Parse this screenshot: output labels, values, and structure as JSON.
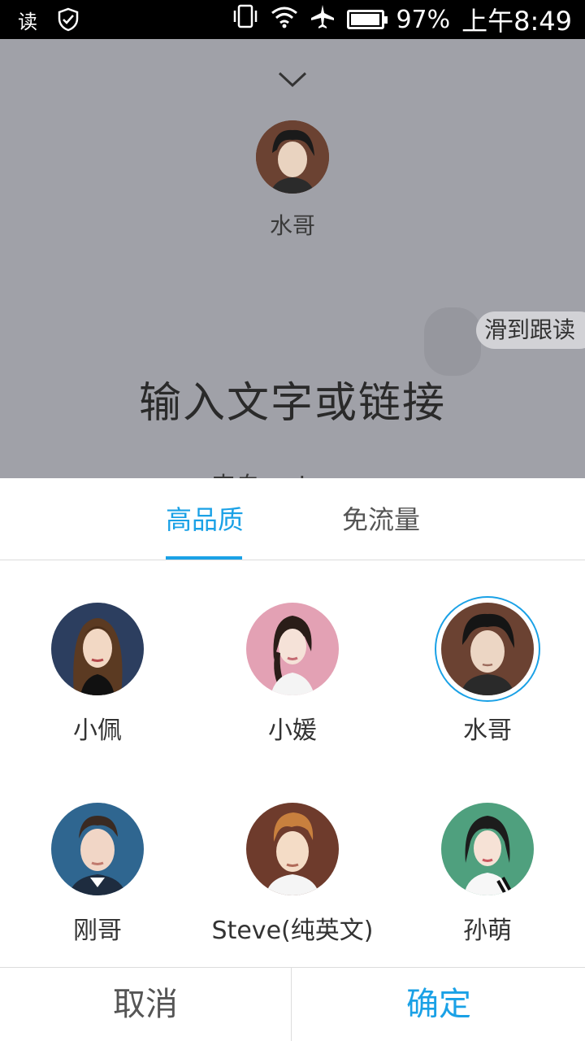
{
  "status_bar": {
    "read_icon_text": "读",
    "battery_percent": "97%",
    "battery_level": 0.97,
    "time": "上午8:49"
  },
  "player": {
    "current_voice_name": "水哥",
    "slide_hint": "滑到跟读",
    "main_text": "输入文字或链接",
    "cut_text": "来自 ... i"
  },
  "tabs": [
    {
      "label": "高品质",
      "active": true
    },
    {
      "label": "免流量",
      "active": false
    }
  ],
  "voices": [
    {
      "name": "小佩",
      "selected": false,
      "bg": "#2c3e5f"
    },
    {
      "name": "小媛",
      "selected": false,
      "bg": "#e3a1b4"
    },
    {
      "name": "水哥",
      "selected": true,
      "bg": "#6b4232"
    },
    {
      "name": "刚哥",
      "selected": false,
      "bg": "#2f6690"
    },
    {
      "name": "Steve(纯英文)",
      "selected": false,
      "bg": "#6e3b2c"
    },
    {
      "name": "孙萌",
      "selected": false,
      "bg": "#4fa07e"
    }
  ],
  "actions": {
    "cancel": "取消",
    "confirm": "确定"
  },
  "colors": {
    "accent": "#1aa1e6",
    "overlay": "#a0a1a8"
  }
}
